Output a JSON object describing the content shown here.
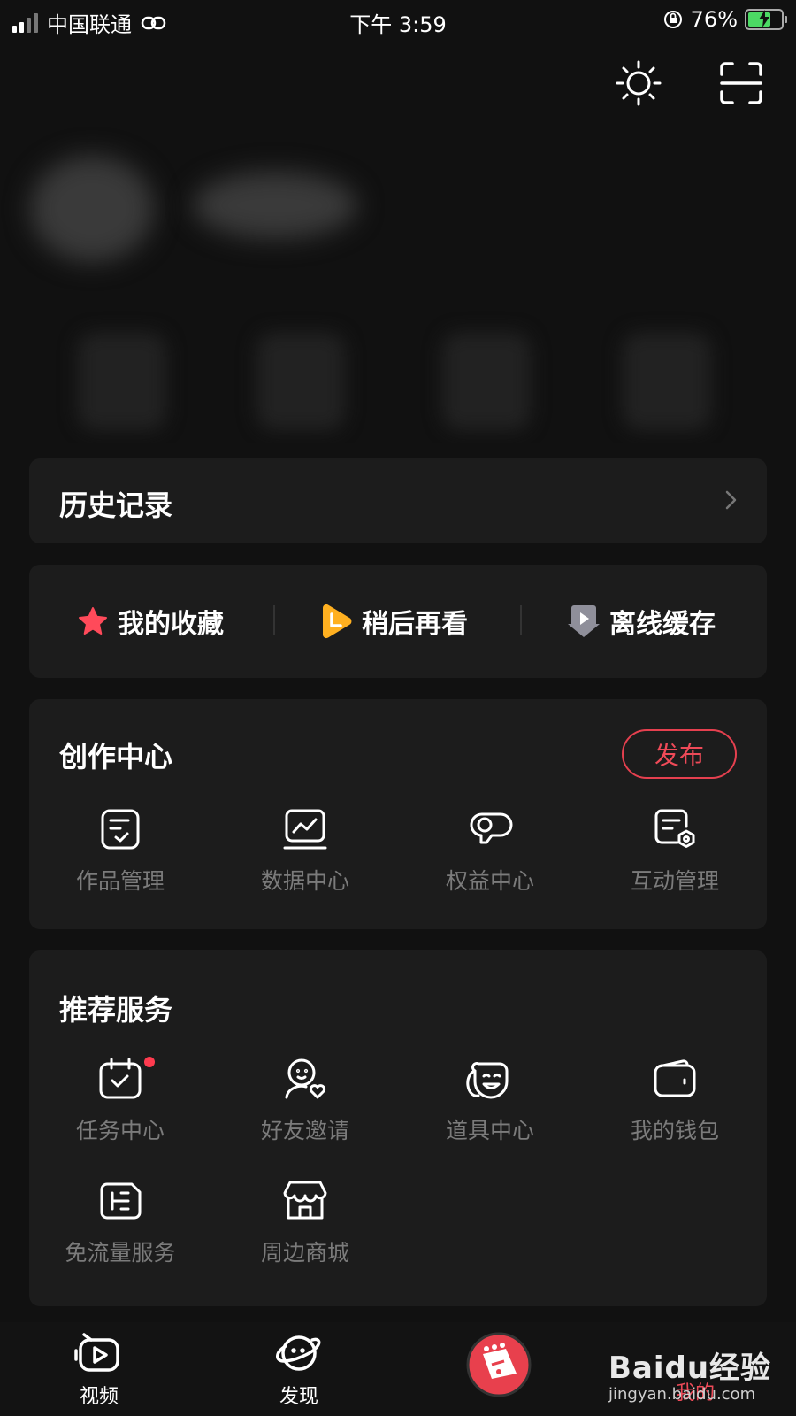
{
  "status_bar": {
    "carrier": "中国联通",
    "time": "下午 3:59",
    "battery": "76%",
    "battery_level": 0.76
  },
  "top_icons": [
    "brightness-icon",
    "scan-icon"
  ],
  "history": {
    "label": "历史记录"
  },
  "quick_links": [
    {
      "label": "我的收藏",
      "icon": "star-icon",
      "color": "#ff4a5a"
    },
    {
      "label": "稍后再看",
      "icon": "watch-later-icon",
      "color": "#ffb020"
    },
    {
      "label": "离线缓存",
      "icon": "download-icon",
      "color": "#9a9aa8"
    }
  ],
  "creator": {
    "title": "创作中心",
    "publish_label": "发布",
    "items": [
      {
        "label": "作品管理",
        "icon": "works-icon"
      },
      {
        "label": "数据中心",
        "icon": "data-chart-icon"
      },
      {
        "label": "权益中心",
        "icon": "rights-icon"
      },
      {
        "label": "互动管理",
        "icon": "interaction-icon"
      }
    ]
  },
  "recommend": {
    "title": "推荐服务",
    "items": [
      {
        "label": "任务中心",
        "icon": "task-calendar-icon",
        "badge": true
      },
      {
        "label": "好友邀请",
        "icon": "friend-invite-icon"
      },
      {
        "label": "道具中心",
        "icon": "props-mask-icon"
      },
      {
        "label": "我的钱包",
        "icon": "wallet-icon"
      },
      {
        "label": "免流量服务",
        "icon": "data-free-icon"
      },
      {
        "label": "周边商城",
        "icon": "store-icon"
      }
    ]
  },
  "tabbar": {
    "tabs": [
      {
        "label": "视频",
        "icon": "video-icon"
      },
      {
        "label": "发现",
        "icon": "planet-icon"
      },
      {
        "label": "",
        "icon": "avatar-center-icon"
      },
      {
        "label": "我的",
        "icon": "mine-icon",
        "active": true
      }
    ]
  },
  "watermark": {
    "logo": "Baidu经验",
    "url": "jingyan.baidu.com"
  },
  "colors": {
    "background": "#111111",
    "card": "#1c1c1c",
    "accent": "#ef4a58"
  }
}
